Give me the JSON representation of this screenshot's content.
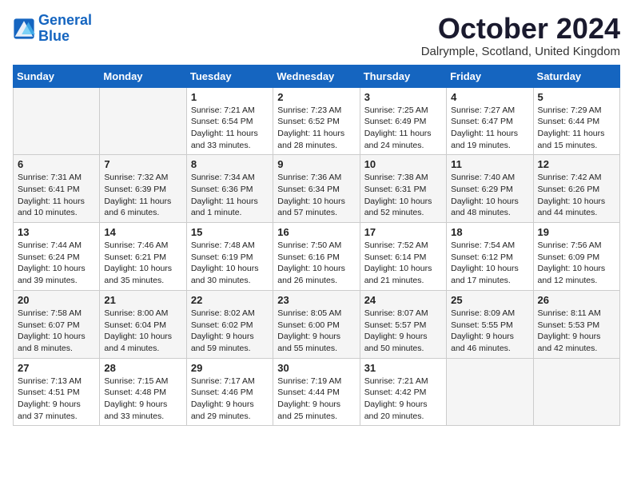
{
  "logo": {
    "line1": "General",
    "line2": "Blue"
  },
  "title": "October 2024",
  "subtitle": "Dalrymple, Scotland, United Kingdom",
  "days_header": [
    "Sunday",
    "Monday",
    "Tuesday",
    "Wednesday",
    "Thursday",
    "Friday",
    "Saturday"
  ],
  "weeks": [
    [
      {
        "day": "",
        "info": ""
      },
      {
        "day": "",
        "info": ""
      },
      {
        "day": "1",
        "info": "Sunrise: 7:21 AM\nSunset: 6:54 PM\nDaylight: 11 hours\nand 33 minutes."
      },
      {
        "day": "2",
        "info": "Sunrise: 7:23 AM\nSunset: 6:52 PM\nDaylight: 11 hours\nand 28 minutes."
      },
      {
        "day": "3",
        "info": "Sunrise: 7:25 AM\nSunset: 6:49 PM\nDaylight: 11 hours\nand 24 minutes."
      },
      {
        "day": "4",
        "info": "Sunrise: 7:27 AM\nSunset: 6:47 PM\nDaylight: 11 hours\nand 19 minutes."
      },
      {
        "day": "5",
        "info": "Sunrise: 7:29 AM\nSunset: 6:44 PM\nDaylight: 11 hours\nand 15 minutes."
      }
    ],
    [
      {
        "day": "6",
        "info": "Sunrise: 7:31 AM\nSunset: 6:41 PM\nDaylight: 11 hours\nand 10 minutes."
      },
      {
        "day": "7",
        "info": "Sunrise: 7:32 AM\nSunset: 6:39 PM\nDaylight: 11 hours\nand 6 minutes."
      },
      {
        "day": "8",
        "info": "Sunrise: 7:34 AM\nSunset: 6:36 PM\nDaylight: 11 hours\nand 1 minute."
      },
      {
        "day": "9",
        "info": "Sunrise: 7:36 AM\nSunset: 6:34 PM\nDaylight: 10 hours\nand 57 minutes."
      },
      {
        "day": "10",
        "info": "Sunrise: 7:38 AM\nSunset: 6:31 PM\nDaylight: 10 hours\nand 52 minutes."
      },
      {
        "day": "11",
        "info": "Sunrise: 7:40 AM\nSunset: 6:29 PM\nDaylight: 10 hours\nand 48 minutes."
      },
      {
        "day": "12",
        "info": "Sunrise: 7:42 AM\nSunset: 6:26 PM\nDaylight: 10 hours\nand 44 minutes."
      }
    ],
    [
      {
        "day": "13",
        "info": "Sunrise: 7:44 AM\nSunset: 6:24 PM\nDaylight: 10 hours\nand 39 minutes."
      },
      {
        "day": "14",
        "info": "Sunrise: 7:46 AM\nSunset: 6:21 PM\nDaylight: 10 hours\nand 35 minutes."
      },
      {
        "day": "15",
        "info": "Sunrise: 7:48 AM\nSunset: 6:19 PM\nDaylight: 10 hours\nand 30 minutes."
      },
      {
        "day": "16",
        "info": "Sunrise: 7:50 AM\nSunset: 6:16 PM\nDaylight: 10 hours\nand 26 minutes."
      },
      {
        "day": "17",
        "info": "Sunrise: 7:52 AM\nSunset: 6:14 PM\nDaylight: 10 hours\nand 21 minutes."
      },
      {
        "day": "18",
        "info": "Sunrise: 7:54 AM\nSunset: 6:12 PM\nDaylight: 10 hours\nand 17 minutes."
      },
      {
        "day": "19",
        "info": "Sunrise: 7:56 AM\nSunset: 6:09 PM\nDaylight: 10 hours\nand 12 minutes."
      }
    ],
    [
      {
        "day": "20",
        "info": "Sunrise: 7:58 AM\nSunset: 6:07 PM\nDaylight: 10 hours\nand 8 minutes."
      },
      {
        "day": "21",
        "info": "Sunrise: 8:00 AM\nSunset: 6:04 PM\nDaylight: 10 hours\nand 4 minutes."
      },
      {
        "day": "22",
        "info": "Sunrise: 8:02 AM\nSunset: 6:02 PM\nDaylight: 9 hours\nand 59 minutes."
      },
      {
        "day": "23",
        "info": "Sunrise: 8:05 AM\nSunset: 6:00 PM\nDaylight: 9 hours\nand 55 minutes."
      },
      {
        "day": "24",
        "info": "Sunrise: 8:07 AM\nSunset: 5:57 PM\nDaylight: 9 hours\nand 50 minutes."
      },
      {
        "day": "25",
        "info": "Sunrise: 8:09 AM\nSunset: 5:55 PM\nDaylight: 9 hours\nand 46 minutes."
      },
      {
        "day": "26",
        "info": "Sunrise: 8:11 AM\nSunset: 5:53 PM\nDaylight: 9 hours\nand 42 minutes."
      }
    ],
    [
      {
        "day": "27",
        "info": "Sunrise: 7:13 AM\nSunset: 4:51 PM\nDaylight: 9 hours\nand 37 minutes."
      },
      {
        "day": "28",
        "info": "Sunrise: 7:15 AM\nSunset: 4:48 PM\nDaylight: 9 hours\nand 33 minutes."
      },
      {
        "day": "29",
        "info": "Sunrise: 7:17 AM\nSunset: 4:46 PM\nDaylight: 9 hours\nand 29 minutes."
      },
      {
        "day": "30",
        "info": "Sunrise: 7:19 AM\nSunset: 4:44 PM\nDaylight: 9 hours\nand 25 minutes."
      },
      {
        "day": "31",
        "info": "Sunrise: 7:21 AM\nSunset: 4:42 PM\nDaylight: 9 hours\nand 20 minutes."
      },
      {
        "day": "",
        "info": ""
      },
      {
        "day": "",
        "info": ""
      }
    ]
  ]
}
